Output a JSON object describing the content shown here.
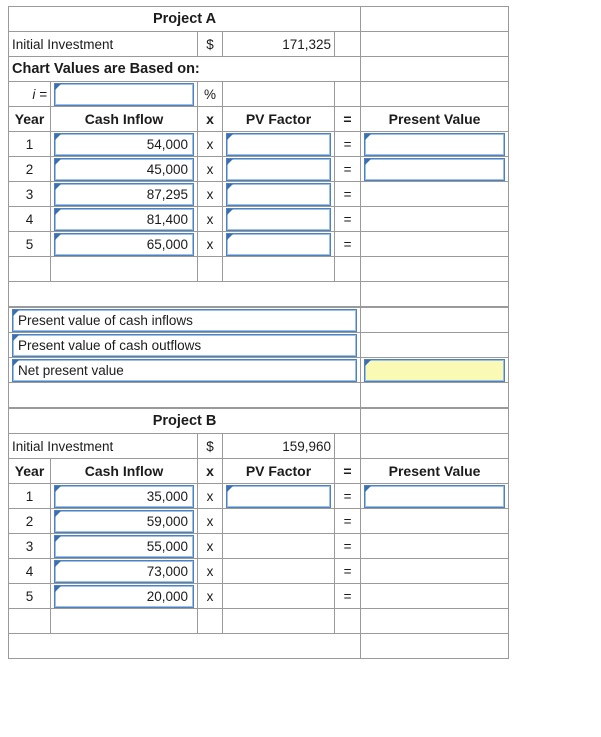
{
  "projects": [
    {
      "title": "Project A",
      "initial_investment_label": "Initial Investment",
      "currency_symbol": "$",
      "initial_investment": "171,325",
      "chart_values_label": "Chart Values are Based on:",
      "rate_label": "i =",
      "rate_value": "",
      "percent_symbol": "%",
      "columns": [
        "Year",
        "Cash Inflow",
        "x",
        "PV Factor",
        "=",
        "Present Value"
      ],
      "rows": [
        {
          "year": "1",
          "cash_inflow": "54,000",
          "times": "x",
          "pv_factor": "",
          "equals": "=",
          "present_value": "",
          "pv_factor_input": true,
          "present_value_input": true
        },
        {
          "year": "2",
          "cash_inflow": "45,000",
          "times": "x",
          "pv_factor": "",
          "equals": "=",
          "present_value": "",
          "pv_factor_input": true,
          "present_value_input": true
        },
        {
          "year": "3",
          "cash_inflow": "87,295",
          "times": "x",
          "pv_factor": "",
          "equals": "=",
          "present_value": "",
          "pv_factor_input": true,
          "present_value_input": false
        },
        {
          "year": "4",
          "cash_inflow": "81,400",
          "times": "x",
          "pv_factor": "",
          "equals": "=",
          "present_value": "",
          "pv_factor_input": true,
          "present_value_input": false
        },
        {
          "year": "5",
          "cash_inflow": "65,000",
          "times": "x",
          "pv_factor": "",
          "equals": "=",
          "present_value": "",
          "pv_factor_input": true,
          "present_value_input": false
        }
      ],
      "total_value": ""
    },
    {
      "title": "Project B",
      "initial_investment_label": "Initial Investment",
      "currency_symbol": "$",
      "initial_investment": "159,960",
      "columns": [
        "Year",
        "Cash Inflow",
        "x",
        "PV Factor",
        "=",
        "Present Value"
      ],
      "rows": [
        {
          "year": "1",
          "cash_inflow": "35,000",
          "times": "x",
          "pv_factor": "",
          "equals": "=",
          "present_value": "",
          "pv_factor_input": true,
          "present_value_input": true
        },
        {
          "year": "2",
          "cash_inflow": "59,000",
          "times": "x",
          "pv_factor": "",
          "equals": "=",
          "present_value": "",
          "pv_factor_input": false,
          "present_value_input": false
        },
        {
          "year": "3",
          "cash_inflow": "55,000",
          "times": "x",
          "pv_factor": "",
          "equals": "=",
          "present_value": "",
          "pv_factor_input": false,
          "present_value_input": false
        },
        {
          "year": "4",
          "cash_inflow": "73,000",
          "times": "x",
          "pv_factor": "",
          "equals": "=",
          "present_value": "",
          "pv_factor_input": false,
          "present_value_input": false
        },
        {
          "year": "5",
          "cash_inflow": "20,000",
          "times": "x",
          "pv_factor": "",
          "equals": "=",
          "present_value": "",
          "pv_factor_input": false,
          "present_value_input": false
        }
      ],
      "total_value": ""
    }
  ],
  "summary": {
    "rows": [
      {
        "label": "Present value of cash inflows",
        "value": "",
        "highlight": false
      },
      {
        "label": "Present value of cash outflows",
        "value": "",
        "highlight": false
      },
      {
        "label": "Net present value",
        "value": "",
        "highlight": true
      }
    ]
  },
  "colors": {
    "header_blue": "#7BA9E0",
    "input_border": "#4F81BD",
    "highlight_yellow": "#FAFAB4",
    "grid_line": "#9a9a9a"
  }
}
